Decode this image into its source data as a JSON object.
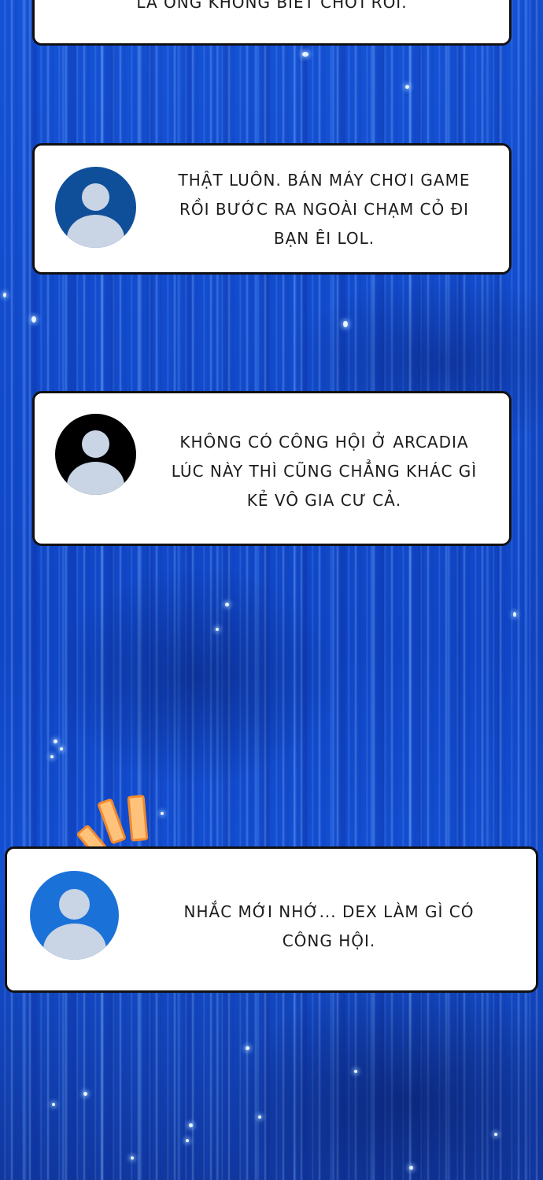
{
  "messages": [
    {
      "text": "LÀ ÔNG KHÔNG BIẾT CHƠI RỒI."
    },
    {
      "text": "THẬT LUÔN. BÁN MÁY CHƠI GAME RỒI BƯỚC RA NGOÀI CHẠM CỎ ĐI BẠN ÊI LOL.",
      "avatar_color": "#0f4f9a"
    },
    {
      "text": "KHÔNG CÓ CÔNG HỘI Ở ARCADIA LÚC NÀY THÌ CŨNG CHẲNG KHÁC GÌ KẺ VÔ GIA CƯ CẢ.",
      "avatar_color": "#000000"
    },
    {
      "text": "NHẮC MỚI NHỚ... DEX LÀM GÌ CÓ CÔNG HỘI.",
      "avatar_color": "#1a72d8"
    }
  ],
  "icons": [
    "default-user-avatar-icon",
    "surprise-burst-icon"
  ],
  "colors": {
    "background": "#1150d0",
    "bubble": "#ffffff",
    "bubble_border": "#111111",
    "burst_fill": "#ffc27a",
    "burst_stroke": "#f28a2c"
  }
}
